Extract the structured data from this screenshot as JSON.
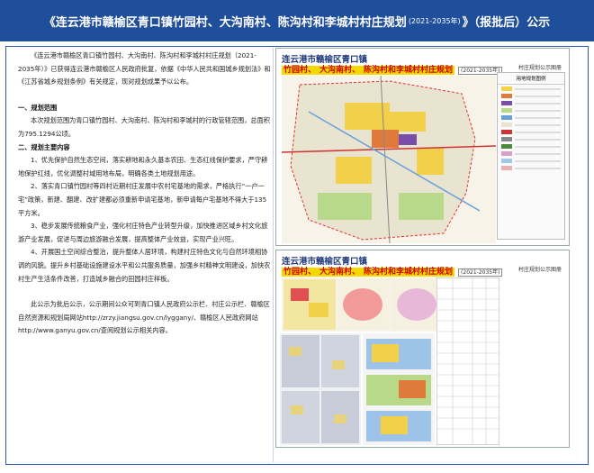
{
  "header": {
    "title_main": "《连云港市赣榆区青口镇竹园村、大沟南村、陈沟村和李城村村庄规划",
    "title_years": "(2021-2035年)",
    "title_tail": "》（报批后）公示"
  },
  "body": {
    "intro": "《连云港市赣榆区青口镇竹园村、大沟南村、陈沟村和李城村村庄规划（2021-2035年）》已获得连云港市赣榆区人民政府批复，依据《中华人民共和国城乡规划法》和《江苏省城乡规划条例》有关规定，现对规划成果予以公布。",
    "s1_heading": "一、规划范围",
    "s1_text": "本次规划范围为青口镇竹园村、大沟南村、陈沟村和李城村的行政管辖范围，总面积为795.1294公顷。",
    "s2_heading": "二、规划主要内容",
    "items": [
      "1、优先保护自然生态空间，落实耕地和永久基本农田、生态红线保护要求，严守耕地保护红线，优化调整村域用地布局，明确各类土地规划用途。",
      "2、落实青口镇竹园村等四村近期村庄发展中农村宅基地的需求，严格执行“一户一宅”政策，新建、翻建、改扩建都必须重新申请宅基地，新申请每户宅基地不得大于135平方米。",
      "3、稳步发展传统粮食产业，强化村庄特色产业转型升级，加快推进区域乡村文化旅游产业发展，促进与周边旅游融合发展，提高整体产业效益，实现产业兴旺。",
      "4、开展国土空间综合整治，提升整体人居环境，构建村庄特色文化与自然环境相协调的风貌。提升乡村基础设施建设水平和公共服务质量，加强乡村精神文明建设，加快农村生产生活条件改善，打造城乡融合的田园村庄样板。"
    ],
    "closing": "此公示为批后公示，公示期间公众可到青口镇人民政府公示栏、村庄公示栏、赣榆区自然资源和规划局网站http://zrzy.jiangsu.gov.cn/lyggany/、赣榆区人民政府网站http://www.ganyu.gov.cn/查阅规划公示相关内容。"
  },
  "panel_top": {
    "title": "连云港市赣榆区青口镇",
    "sub1": "竹园村、",
    "sub2": "大沟南村、",
    "sub3": "陈沟村和李城村村庄规划",
    "years": "(2021-2035年)",
    "label": "村庄规划公示图册",
    "legend_title": "用地规划图例"
  },
  "panel_bottom": {
    "title": "连云港市赣榆区青口镇",
    "sub1": "竹园村、",
    "sub2": "大沟南村、",
    "sub3": "陈沟村和李城村村庄规划",
    "years": "(2021-2035年)",
    "label": "村庄规划公示图册"
  },
  "colors": {
    "header_bg": "#1f4e9a",
    "highlight_bg": "#f5d800",
    "highlight_text": "#cc0000"
  }
}
